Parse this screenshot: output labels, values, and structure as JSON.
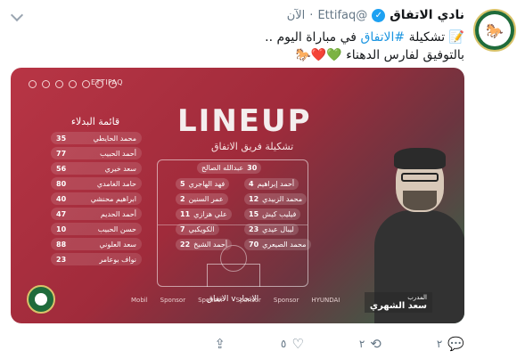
{
  "tweet": {
    "account_name": "نادي الاتفاق",
    "handle": "@Ettifaq",
    "dot": "·",
    "time": "الآن",
    "text_line1_pre": "📝 تشكيلة ",
    "text_hashtag": "#الاتفاق",
    "text_line1_post": " في مباراة اليوم ..",
    "text_line2": "بالتوفيق لفارس الدهناء 💚❤️🐎",
    "media": {
      "brand": "ETTIFAQ",
      "title": "LINEUP",
      "subtitle": "تشكيلة فريق الاتفاق",
      "subs_title": "قائمة البدلاء",
      "subs": [
        {
          "num": "35",
          "name": "محمد الحايطي"
        },
        {
          "num": "77",
          "name": "أحمد الحبيب"
        },
        {
          "num": "56",
          "name": "سعد خيري"
        },
        {
          "num": "80",
          "name": "حامد الغامدي"
        },
        {
          "num": "40",
          "name": "ابراهيم محنشي"
        },
        {
          "num": "47",
          "name": "أحمد الحديم"
        },
        {
          "num": "10",
          "name": "حسن الحبيب"
        },
        {
          "num": "88",
          "name": "سعد العلوني"
        },
        {
          "num": "23",
          "name": "نواف بوعامر"
        }
      ],
      "players": {
        "gk": {
          "num": "30",
          "name": "عبدالله الصالح"
        },
        "p1": {
          "num": "5",
          "name": "فهد الهاجري"
        },
        "p2": {
          "num": "4",
          "name": "أحمد إبراهيم"
        },
        "p3": {
          "num": "2",
          "name": "عمر السنين"
        },
        "p4": {
          "num": "12",
          "name": "محمد الزبيدي"
        },
        "p5": {
          "num": "11",
          "name": "علي هزازي"
        },
        "p6": {
          "num": "15",
          "name": "فيليب كيش"
        },
        "p7": {
          "num": "7",
          "name": "الكويكبي"
        },
        "p8": {
          "num": "23",
          "name": "ليبال عيدي"
        },
        "p9": {
          "num": "22",
          "name": "أحمد الشيخ"
        },
        "p10": {
          "num": "70",
          "name": "محمد الصيعري"
        }
      },
      "match": "الاتحاد v الاتفاق",
      "coach_role": "المدرب",
      "coach_name": "سعد الشهري",
      "sponsors": [
        "Mobil",
        "Sponsor",
        "Sponsor",
        "Sponsor",
        "Sponsor",
        "HYUNDAI"
      ]
    },
    "actions": {
      "reply_count": "٢",
      "retweet_count": "٢",
      "like_count": "٥"
    },
    "icons": [
      "verified-icon",
      "caret-down-icon",
      "reply-icon",
      "retweet-icon",
      "like-icon",
      "share-icon"
    ],
    "colors": {
      "hashtag": "#1b95e0",
      "verified": "#1da1f2",
      "brand_green": "#1f6b3b",
      "brand_red": "#b83545"
    }
  }
}
